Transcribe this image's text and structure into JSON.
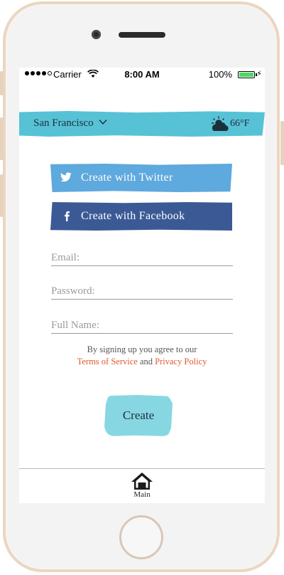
{
  "status_bar": {
    "carrier": "Carrier",
    "time": "8:00 AM",
    "battery": "100%",
    "icons": [
      "signal-dots",
      "wifi-icon",
      "battery-icon",
      "bolt-icon"
    ]
  },
  "location": {
    "city": "San Francisco",
    "temperature": "66°F",
    "weather_icon": "partly-cloudy-icon",
    "bar_color": "#57c2d6"
  },
  "social": {
    "twitter_label": "Create with Twitter",
    "facebook_label": "Create with Facebook",
    "twitter_color": "#5ea9dd",
    "facebook_color": "#3b5a95"
  },
  "form": {
    "email_placeholder": "Email:",
    "password_placeholder": "Password:",
    "name_placeholder": "Full Name:",
    "email_value": "",
    "password_value": "",
    "name_value": ""
  },
  "terms": {
    "prefix": "By signing up you agree to our",
    "terms_link": "Terms of Service",
    "conjunction": "and",
    "privacy_link": "Privacy Policy",
    "link_color": "#e0582c"
  },
  "create_button": {
    "label": "Create",
    "color": "#87d7e3"
  },
  "tab_bar": {
    "main_label": "Main",
    "main_icon": "house-icon"
  }
}
